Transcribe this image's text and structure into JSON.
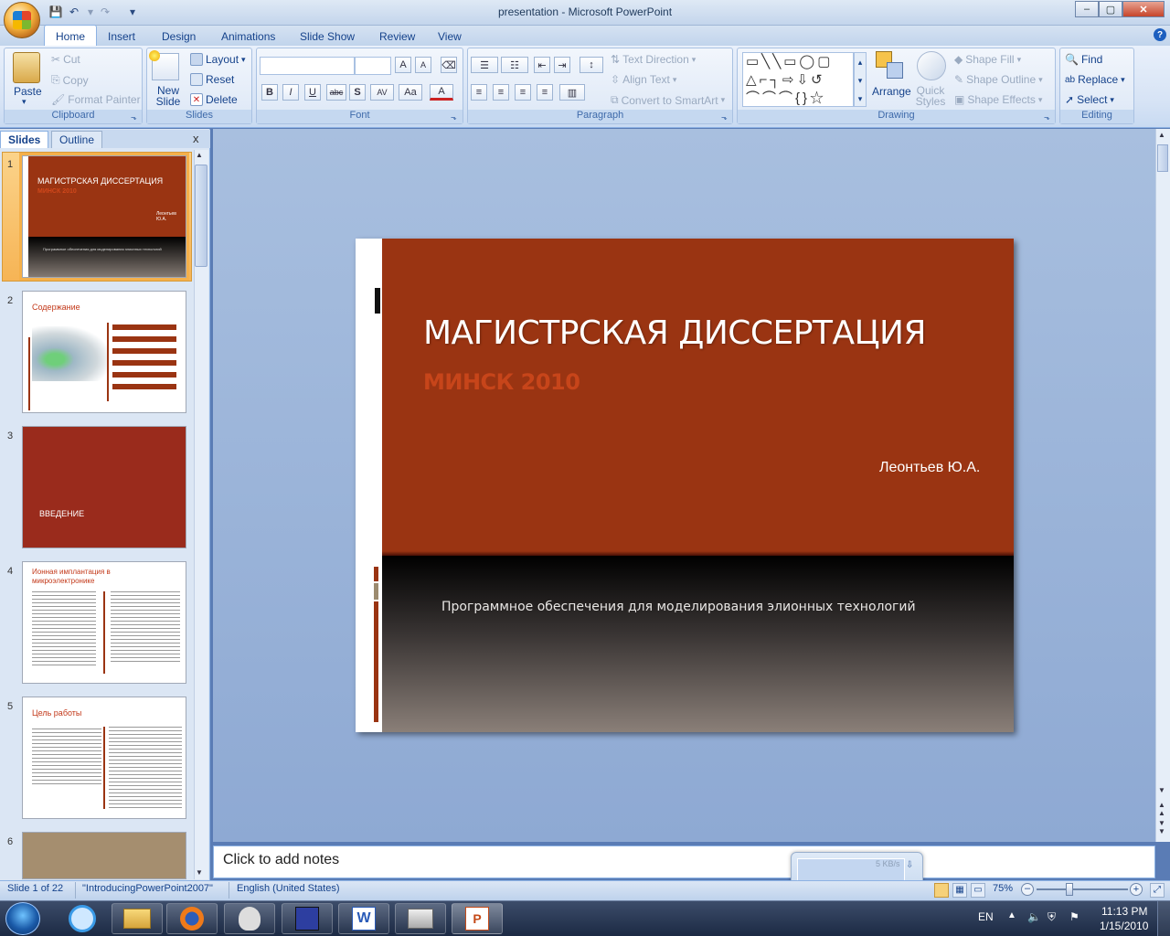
{
  "window": {
    "title": "presentation - Microsoft PowerPoint",
    "qat_undo": "↶",
    "qat_redo": "↷",
    "min": "–",
    "max": "▢",
    "close": "✕"
  },
  "tabs": [
    "Home",
    "Insert",
    "Design",
    "Animations",
    "Slide Show",
    "Review",
    "View"
  ],
  "ribbon": {
    "clipboard": {
      "label": "Clipboard",
      "paste": "Paste",
      "cut": "Cut",
      "copy": "Copy",
      "format_painter": "Format Painter"
    },
    "slides": {
      "label": "Slides",
      "new_slide": "New Slide",
      "layout": "Layout",
      "reset": "Reset",
      "delete": "Delete"
    },
    "font": {
      "label": "Font",
      "bold": "B",
      "italic": "I",
      "underline": "U",
      "strike": "abc",
      "shadow": "S",
      "spacing": "AV",
      "case": "Aa",
      "color": "A",
      "grow": "A",
      "shrink": "A"
    },
    "paragraph": {
      "label": "Paragraph",
      "text_direction": "Text Direction",
      "align_text": "Align Text",
      "convert_smartart": "Convert to SmartArt"
    },
    "drawing": {
      "label": "Drawing",
      "arrange": "Arrange",
      "quick_styles": "Quick Styles",
      "shape_fill": "Shape Fill",
      "shape_outline": "Shape Outline",
      "shape_effects": "Shape Effects"
    },
    "editing": {
      "label": "Editing",
      "find": "Find",
      "replace": "Replace",
      "select": "Select"
    }
  },
  "pane": {
    "tab_slides": "Slides",
    "tab_outline": "Outline",
    "close": "x",
    "thumbnails": [
      {
        "num": "1",
        "title": "МАГИСТРСКАЯ ДИССЕРТАЦИЯ",
        "sub": "МИНСК 2010",
        "author": "Леонтьев Ю.А.",
        "caption": "Программное обеспечения для моделирования элионных технологий"
      },
      {
        "num": "2",
        "title": "Содержание"
      },
      {
        "num": "3",
        "title": "ВВЕДЕНИЕ"
      },
      {
        "num": "4",
        "title": "Ионная имплантация в микроэлектронике"
      },
      {
        "num": "5",
        "title": "Цель работы"
      },
      {
        "num": "6"
      }
    ]
  },
  "slide": {
    "title": "МАГИСТРСКАЯ ДИССЕРТАЦИЯ",
    "subtitle": "МИНСК 2010",
    "author": "Леонтьев Ю.А.",
    "caption": "Программное обеспечения для моделирования элионных технологий"
  },
  "notes": {
    "placeholder": "Click to add notes"
  },
  "net_widget": {
    "speed": "5 KB/s"
  },
  "status": {
    "slide_count": "Slide 1 of 22",
    "theme": "\"IntroducingPowerPoint2007\"",
    "language": "English (United States)",
    "zoom": "75%"
  },
  "taskbar": {
    "lang": "EN",
    "time": "11:13 PM",
    "date": "1/15/2010"
  },
  "colors": {
    "slide_red": "#9a3412",
    "subtitle_orange": "#d0481c",
    "selection": "#f6b455"
  }
}
